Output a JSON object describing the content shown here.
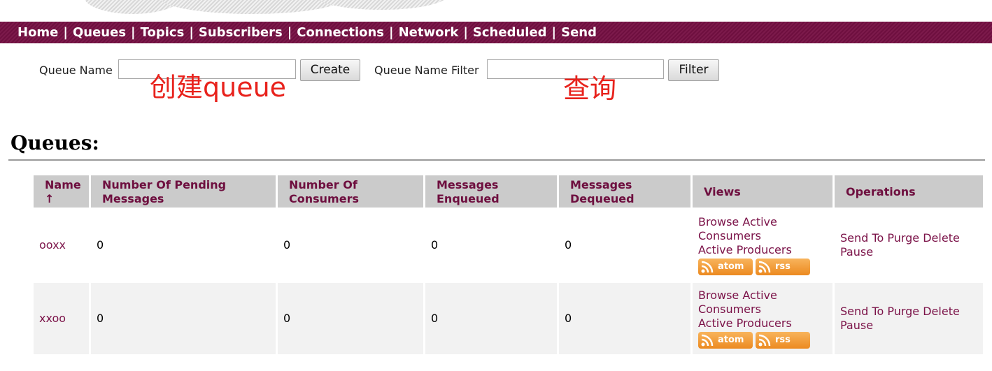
{
  "nav": {
    "items": [
      "Home",
      "Queues",
      "Topics",
      "Subscribers",
      "Connections",
      "Network",
      "Scheduled",
      "Send"
    ],
    "separator": "|"
  },
  "create_form": {
    "label": "Queue Name",
    "value": "",
    "button": "Create",
    "annotation": "创建queue"
  },
  "filter_form": {
    "label": "Queue Name Filter",
    "value": "",
    "button": "Filter",
    "annotation": "查询"
  },
  "section_title": "Queues:",
  "table": {
    "headers": [
      "Name ↑",
      "Number Of Pending Messages",
      "Number Of Consumers",
      "Messages Enqueued",
      "Messages Dequeued",
      "Views",
      "Operations"
    ],
    "rows": [
      {
        "name": "ooxx",
        "pending": "0",
        "consumers": "0",
        "enqueued": "0",
        "dequeued": "0"
      },
      {
        "name": "xxoo",
        "pending": "0",
        "consumers": "0",
        "enqueued": "0",
        "dequeued": "0"
      }
    ],
    "views": {
      "browse": "Browse",
      "active_consumers": "Active Consumers",
      "active_producers": "Active Producers",
      "atom": "atom",
      "rss": "rss"
    },
    "operations": {
      "send_to": "Send To",
      "purge": "Purge",
      "delete": "Delete",
      "pause": "Pause"
    }
  },
  "colors": {
    "nav_bg": "#6e0f3f",
    "link": "#7b1248",
    "header_bg": "#cbcbcb",
    "annotation": "#e8221c",
    "feed": "#ec8a20"
  }
}
